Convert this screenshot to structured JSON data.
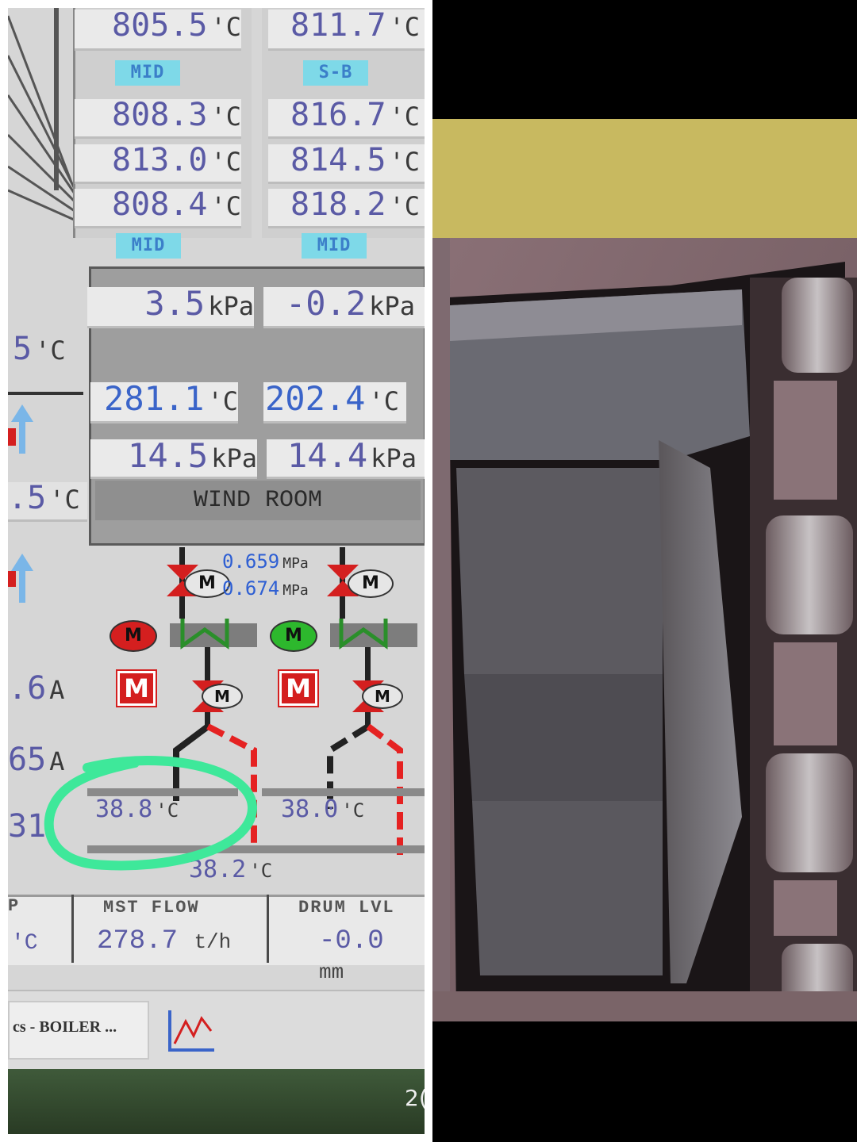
{
  "left_screen": {
    "top_values": {
      "left_col": [
        {
          "value": "805.5",
          "unit": "'C"
        },
        {
          "value": "808.3",
          "unit": "'C"
        },
        {
          "value": "813.0",
          "unit": "'C"
        },
        {
          "value": "808.4",
          "unit": "'C"
        }
      ],
      "right_col": [
        {
          "value": "811.7",
          "unit": "'C"
        },
        {
          "value": "816.7",
          "unit": "'C"
        },
        {
          "value": "814.5",
          "unit": "'C"
        },
        {
          "value": "818.2",
          "unit": "'C"
        }
      ]
    },
    "tags": {
      "mid_1": "MID",
      "sb": "S-B",
      "mid_2": "MID",
      "mid_3": "MID"
    },
    "kpa_row1": [
      {
        "value": "3.5",
        "unit": "kPa"
      },
      {
        "value": "-0.2",
        "unit": "kPa"
      }
    ],
    "temp_row": [
      {
        "value": "281.1",
        "unit": "'C"
      },
      {
        "value": "202.4",
        "unit": "'C"
      }
    ],
    "kpa_row2": [
      {
        "value": "14.5",
        "unit": "kPa"
      },
      {
        "value": "14.4",
        "unit": "kPa"
      }
    ],
    "left_partials": [
      {
        "value": "5",
        "unit": "'C"
      },
      {
        "value": ".5",
        "unit": "'C"
      },
      {
        "value": ".6",
        "unit": "A"
      },
      {
        "value": "65",
        "unit": "A"
      },
      {
        "value": "31",
        "unit": ""
      }
    ],
    "wind_room_label": "WIND ROOM",
    "pressures": [
      {
        "value": "0.659",
        "unit": "MPa"
      },
      {
        "value": "0.674",
        "unit": "MPa"
      }
    ],
    "motor_labels": {
      "left_circle": "M",
      "right_circle": "M",
      "left_box": "M",
      "right_box": "M"
    },
    "bottom_temps": [
      {
        "value": "38.8",
        "unit": "'C"
      },
      {
        "value": "38.0",
        "unit": "'C"
      },
      {
        "value": "38.2",
        "unit": "'C"
      }
    ],
    "status_bar": {
      "col1_header": "P",
      "col1_unit": "'C",
      "mst_flow_label": "MST FLOW",
      "mst_flow_value": "278.7",
      "mst_flow_unit": "t/h",
      "drum_lvl_label": "DRUM LVL",
      "drum_lvl_value": "-0.0",
      "drum_lvl_unit": "mm"
    },
    "taskbar": {
      "tab_label": "cs - BOILER ...",
      "chart_icon": "trend-chart-icon"
    },
    "corner_text": "2("
  },
  "colors": {
    "value_text": "#5a5aa5",
    "tag_bg": "#7ed9e8",
    "alarm_red": "#d41f1f",
    "ok_green": "#2db82d",
    "highlight_green": "#3ee89a"
  }
}
